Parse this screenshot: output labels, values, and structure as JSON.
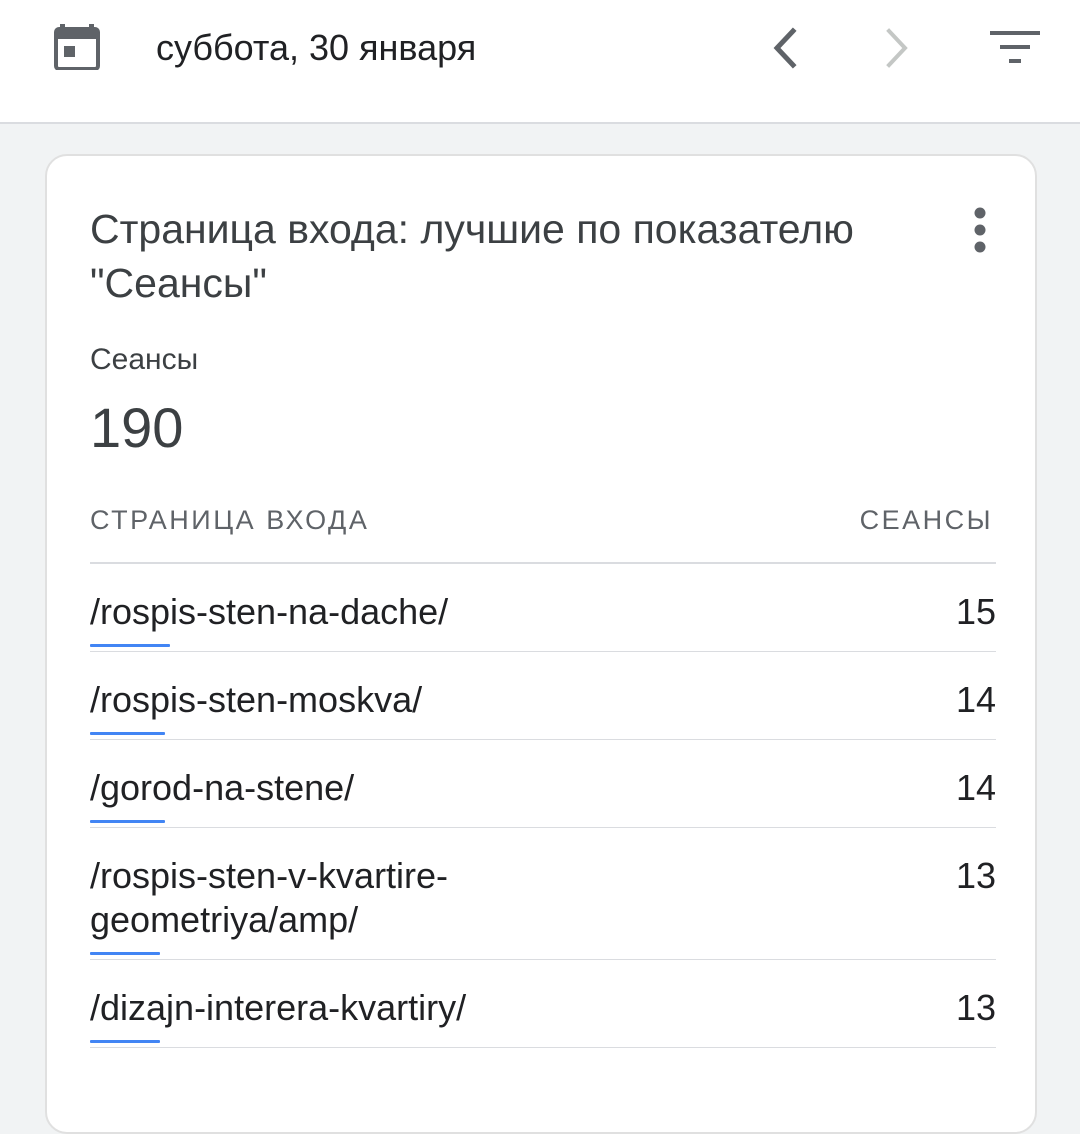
{
  "header": {
    "date": "суббота, 30 января",
    "icons": {
      "calendar": "calendar-icon",
      "prev": "chevron-left-icon",
      "next": "chevron-right-icon",
      "filter": "filter-icon"
    },
    "colors": {
      "icon": "#5f6368",
      "icon_disabled": "#c4c7c5"
    }
  },
  "card": {
    "title": "Страница входа: лучшие по показателю \"Сеансы\"",
    "metric_label": "Сеансы",
    "metric_value": "190",
    "columns": {
      "left": "СТРАНИЦА ВХОДА",
      "right": "СЕАНСЫ"
    },
    "rows": [
      {
        "page": "/rospis-sten-na-dache/",
        "sessions": "15",
        "bar_fraction": 0.088
      },
      {
        "page": "/rospis-sten-moskva/",
        "sessions": "14",
        "bar_fraction": 0.083
      },
      {
        "page": "/gorod-na-stene/",
        "sessions": "14",
        "bar_fraction": 0.083
      },
      {
        "page": "/rospis-sten-v-kvartire-geometriya/amp/",
        "sessions": "13",
        "bar_fraction": 0.077
      },
      {
        "page": "/dizajn-interera-kvartiry/",
        "sessions": "13",
        "bar_fraction": 0.077
      }
    ],
    "accent_color": "#4285f4"
  }
}
